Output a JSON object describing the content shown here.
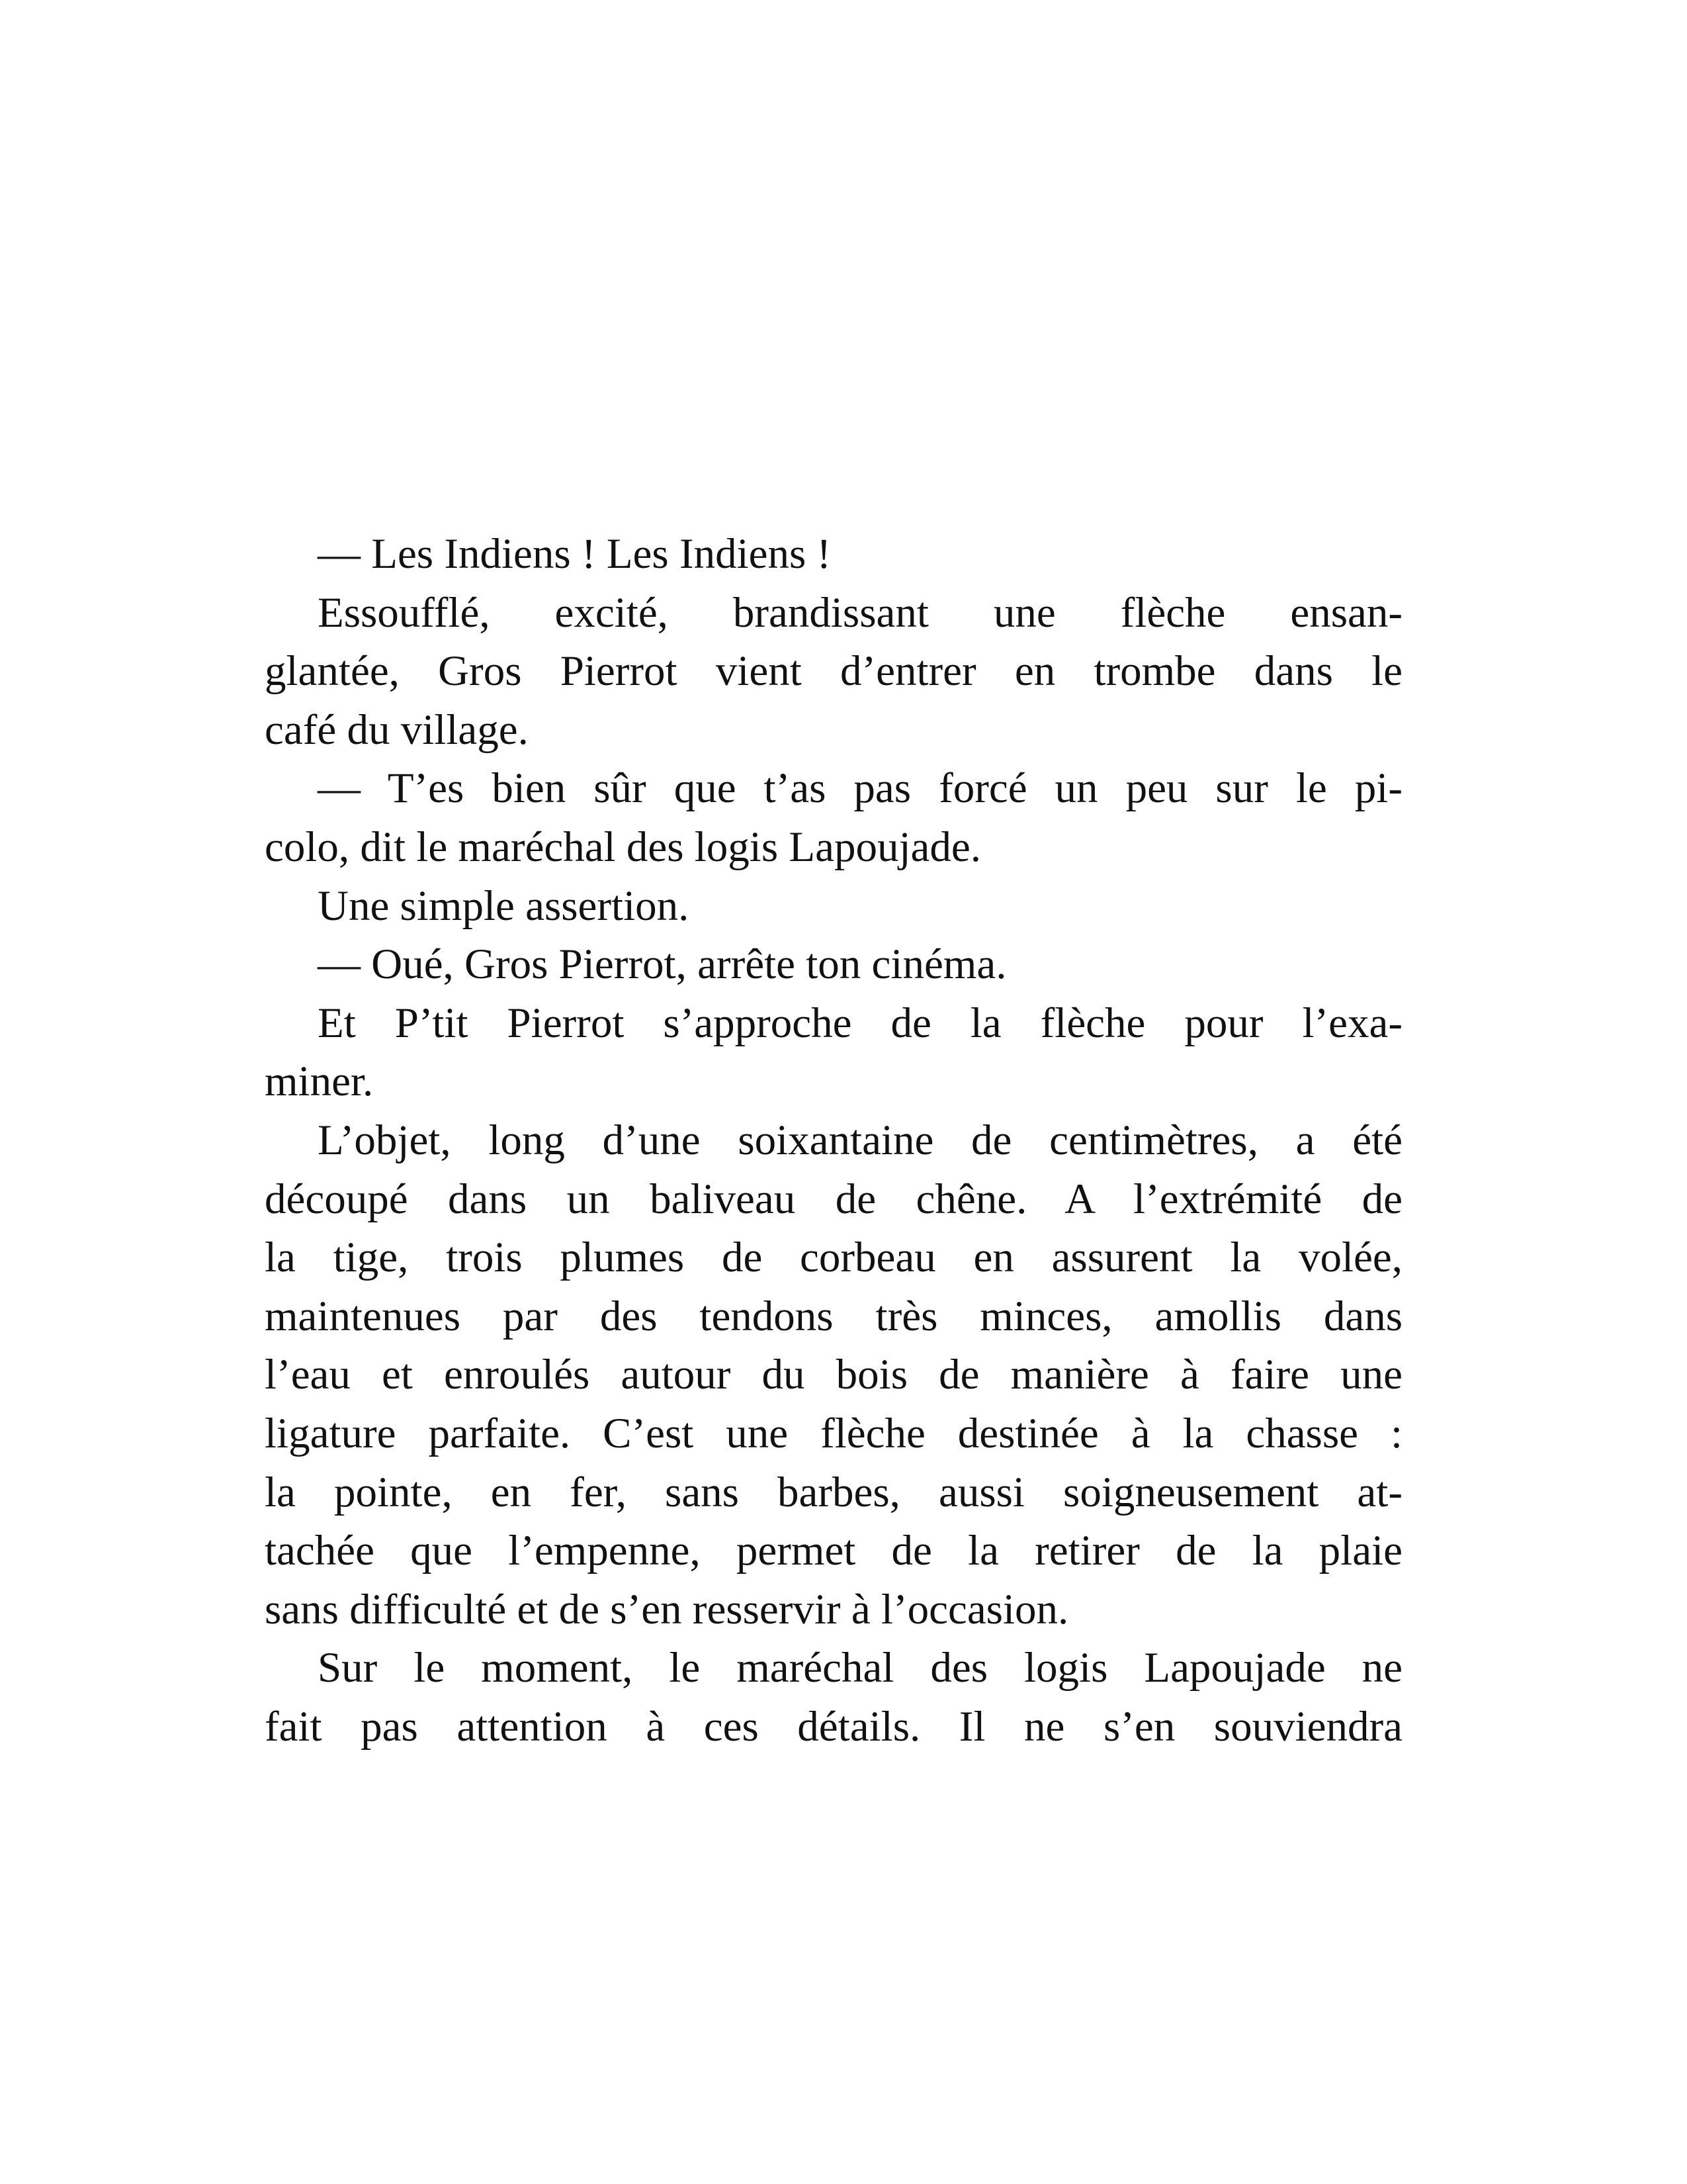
{
  "lines": [
    {
      "text": "— Les Indiens ! Les Indiens !",
      "indent": true,
      "justify": false
    },
    {
      "text": "Essoufflé, excité, brandissant une flèche ensan-",
      "indent": true,
      "justify": true
    },
    {
      "text": "glantée, Gros Pierrot vient d’entrer en trombe dans le",
      "indent": false,
      "justify": true
    },
    {
      "text": "café du village.",
      "indent": false,
      "justify": false
    },
    {
      "text": "— T’es bien sûr que t’as pas forcé un peu sur le pi-",
      "indent": true,
      "justify": true
    },
    {
      "text": "colo, dit le maréchal des logis Lapoujade.",
      "indent": false,
      "justify": false
    },
    {
      "text": "Une simple assertion.",
      "indent": true,
      "justify": false
    },
    {
      "text": "— Oué, Gros Pierrot, arrête ton cinéma.",
      "indent": true,
      "justify": false
    },
    {
      "text": "Et P’tit Pierrot s’approche de la flèche pour l’exa-",
      "indent": true,
      "justify": true
    },
    {
      "text": "miner.",
      "indent": false,
      "justify": false
    },
    {
      "text": "L’objet, long d’une soixantaine de centimètres, a été",
      "indent": true,
      "justify": true
    },
    {
      "text": "découpé dans un baliveau de chêne. A l’extrémité de",
      "indent": false,
      "justify": true
    },
    {
      "text": "la tige, trois plumes de corbeau en assurent la volée,",
      "indent": false,
      "justify": true
    },
    {
      "text": "maintenues par des tendons très minces, amollis dans",
      "indent": false,
      "justify": true
    },
    {
      "text": "l’eau et enroulés autour du bois de manière à faire une",
      "indent": false,
      "justify": true
    },
    {
      "text": "ligature parfaite. C’est une flèche destinée à la chasse :",
      "indent": false,
      "justify": true
    },
    {
      "text": "la pointe, en fer, sans barbes, aussi soigneusement at-",
      "indent": false,
      "justify": true
    },
    {
      "text": "tachée que l’empenne, permet de la retirer de la plaie",
      "indent": false,
      "justify": true
    },
    {
      "text": "sans difficulté et de s’en resservir à l’occasion.",
      "indent": false,
      "justify": false
    },
    {
      "text": "Sur le moment, le maréchal des logis Lapoujade ne",
      "indent": true,
      "justify": true
    },
    {
      "text": "fait pas attention à ces détails. Il ne s’en souviendra",
      "indent": false,
      "justify": true
    }
  ]
}
